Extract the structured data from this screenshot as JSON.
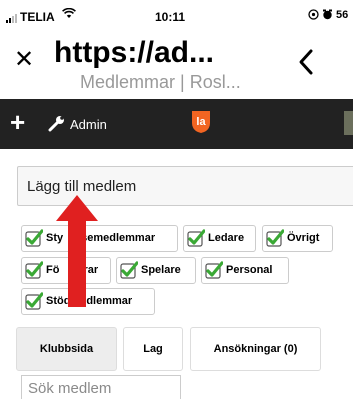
{
  "status_bar": {
    "carrier": "TELIA",
    "time": "10:11",
    "battery": "56"
  },
  "browser": {
    "url": "https://ad...",
    "subtitle": "Medlemmar | Rosl..."
  },
  "toolbar": {
    "admin_label": "Admin"
  },
  "add_member": {
    "label": "Lägg till medlem"
  },
  "filters": [
    {
      "label": "Styrelsemedlemmar",
      "visible_text": "Sty",
      "hidden_tail": "semedlemmar",
      "checked": true
    },
    {
      "label": "Ledare",
      "checked": true
    },
    {
      "label": "Övrigt",
      "checked": true
    },
    {
      "label": "Föräldrar",
      "visible_text": "Fö",
      "hidden_tail": "rar",
      "checked": true
    },
    {
      "label": "Spelare",
      "checked": true
    },
    {
      "label": "Personal",
      "checked": true
    },
    {
      "label": "Stödmedlemmar",
      "checked": true
    }
  ],
  "tabs": [
    {
      "label": "Klubbsida",
      "active": true
    },
    {
      "label": "Lag",
      "active": false
    },
    {
      "label": "Ansökningar (0)",
      "active": false
    }
  ],
  "search": {
    "placeholder": "Sök medlem"
  },
  "colors": {
    "toolbar_bg": "#222222",
    "check_green": "#3aa935",
    "arrow_red": "#e02020",
    "logo_orange": "#f26522"
  }
}
